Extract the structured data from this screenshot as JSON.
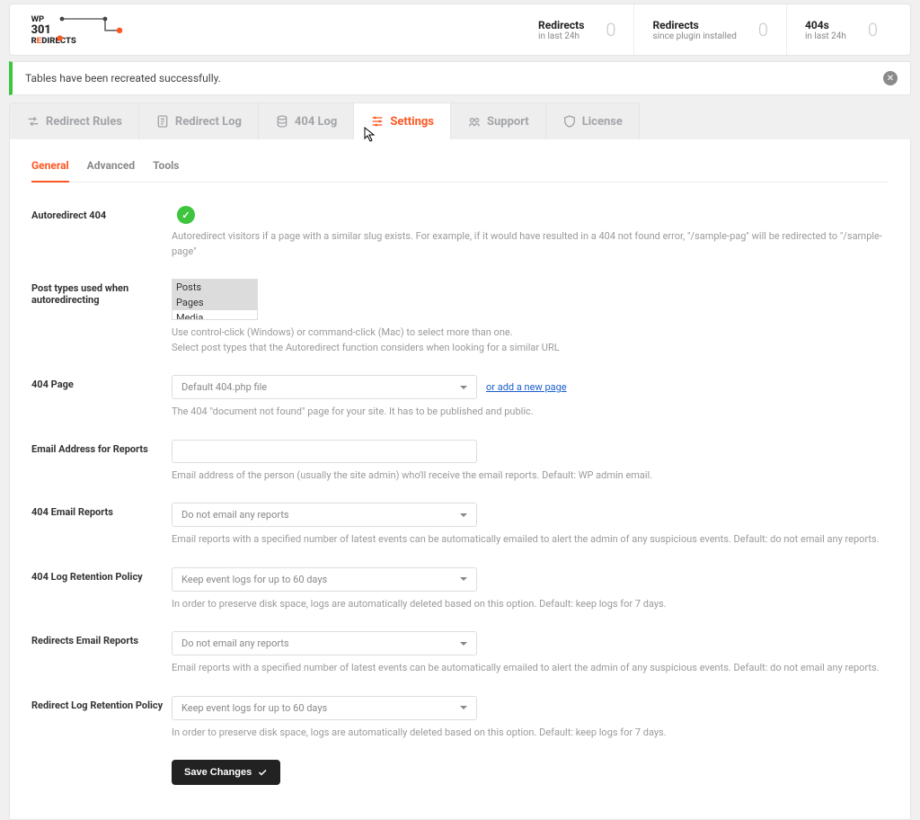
{
  "logo": {
    "wp": "WP",
    "num": "301",
    "redirects": "REDIRECTS"
  },
  "stats": [
    {
      "title": "Redirects",
      "sub": "in last 24h",
      "value": "0"
    },
    {
      "title": "Redirects",
      "sub": "since plugin installed",
      "value": "0"
    },
    {
      "title": "404s",
      "sub": "in last 24h",
      "value": "0"
    }
  ],
  "notice": {
    "text": "Tables have been recreated successfully."
  },
  "tabs": {
    "rules": "Redirect Rules",
    "log": "Redirect Log",
    "fourlog": "404 Log",
    "settings": "Settings",
    "support": "Support",
    "license": "License"
  },
  "subtabs": {
    "general": "General",
    "advanced": "Advanced",
    "tools": "Tools"
  },
  "fields": {
    "autoredirect": {
      "label": "Autoredirect 404",
      "help": "Autoredirect visitors if a page with a similar slug exists. For example, if it would have resulted in a 404 not found error, \"/sample-pag\" will be redirected to \"/sample-page\""
    },
    "posttypes": {
      "label": "Post types used when autoredirecting",
      "options": [
        "Posts",
        "Pages",
        "Media"
      ],
      "help1": "Use control-click (Windows) or command-click (Mac) to select more than one.",
      "help2": "Select post types that the Autoredirect function considers when looking for a similar URL"
    },
    "fourpage": {
      "label": "404 Page",
      "value": "Default 404.php file",
      "link": "or add a new page",
      "help": "The 404 \"document not found\" page for your site. It has to be published and public."
    },
    "email": {
      "label": "Email Address for Reports",
      "help": "Email address of the person (usually the site admin) who'll receive the email reports. Default: WP admin email."
    },
    "fourreports": {
      "label": "404 Email Reports",
      "value": "Do not email any reports",
      "help": "Email reports with a specified number of latest events can be automatically emailed to alert the admin of any suspicious events. Default: do not email any reports."
    },
    "fourretention": {
      "label": "404 Log Retention Policy",
      "value": "Keep event logs for up to 60 days",
      "help": "In order to preserve disk space, logs are automatically deleted based on this option. Default: keep logs for 7 days."
    },
    "redirreports": {
      "label": "Redirects Email Reports",
      "value": "Do not email any reports",
      "help": "Email reports with a specified number of latest events can be automatically emailed to alert the admin of any suspicious events. Default: do not email any reports."
    },
    "redirretention": {
      "label": "Redirect Log Retention Policy",
      "value": "Keep event logs for up to 60 days",
      "help": "In order to preserve disk space, logs are automatically deleted based on this option. Default: keep logs for 7 days."
    },
    "save": "Save Changes"
  }
}
